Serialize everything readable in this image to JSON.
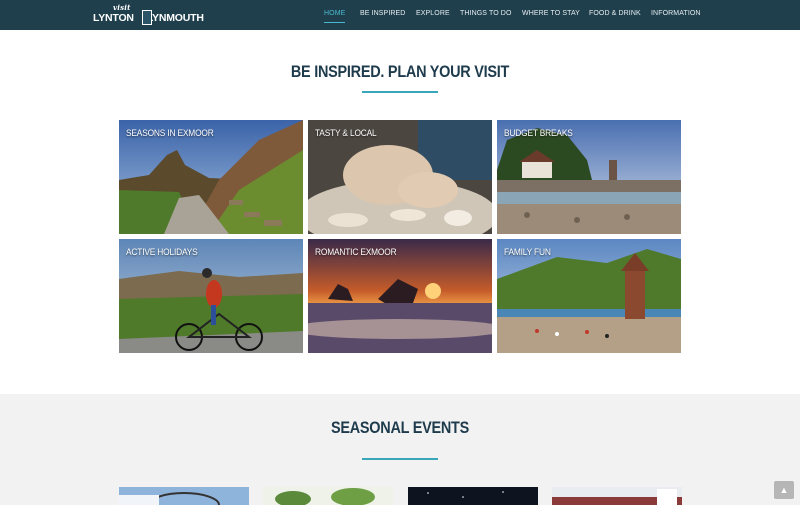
{
  "header": {
    "logo_small": "visit",
    "logo_left": "LYNTON",
    "logo_right": "LYNMOUTH",
    "nav": [
      {
        "label": "HOME",
        "active": true
      },
      {
        "label": "BE INSPIRED",
        "active": false
      },
      {
        "label": "EXPLORE",
        "active": false
      },
      {
        "label": "THINGS TO DO",
        "active": false
      },
      {
        "label": "WHERE TO STAY",
        "active": false
      },
      {
        "label": "FOOD & DRINK",
        "active": false
      },
      {
        "label": "INFORMATION",
        "active": false
      }
    ]
  },
  "inspired": {
    "title": "BE INSPIRED. PLAN YOUR VISIT",
    "tiles": [
      {
        "label": "SEASONS IN EXMOOR"
      },
      {
        "label": "TASTY & LOCAL"
      },
      {
        "label": "BUDGET BREAKS"
      },
      {
        "label": "ACTIVE HOLIDAYS"
      },
      {
        "label": "ROMANTIC EXMOOR"
      },
      {
        "label": "FAMILY FUN"
      }
    ]
  },
  "seasonal": {
    "title": "SEASONAL EVENTS"
  },
  "colors": {
    "header_bg": "#1f3f4d",
    "accent": "#4ab8cf",
    "title_text": "#1e3b4c",
    "section_bg": "#f2f2f2"
  },
  "icons": {
    "back_to_top": "arrow-up-icon"
  }
}
